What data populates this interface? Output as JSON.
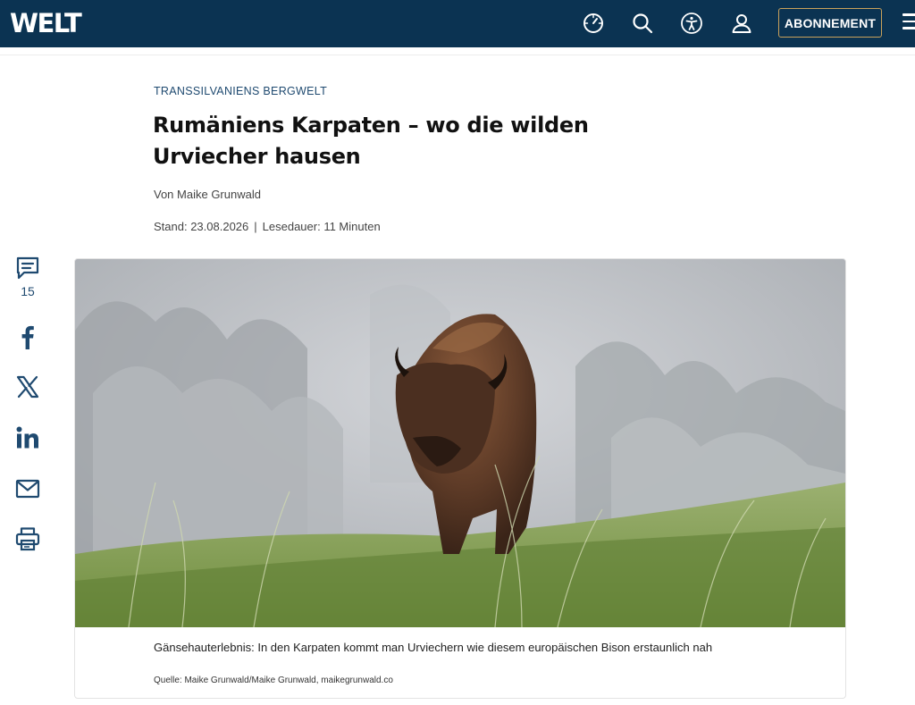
{
  "header": {
    "logo": "WELT",
    "subscribe_label": "ABONNEMENT",
    "icons": [
      "clock-icon",
      "search-icon",
      "accessibility-icon",
      "user-icon",
      "menu-icon"
    ],
    "brand_color": "#0b3352",
    "accent_color": "#c9a15b"
  },
  "article": {
    "kicker": "TRANSSILVANIENS BERGWELT",
    "title": "Rumäniens Karpaten – wo die wilden Urviecher hausen",
    "author": "Von Maike Grunwald",
    "stand": "Stand: 23.08.2026",
    "separator": "|",
    "reading_time": "Lesedauer: 11 Minuten"
  },
  "share": {
    "comment_count": "15",
    "icons": [
      "comment-icon",
      "facebook-icon",
      "x-icon",
      "linkedin-icon",
      "mail-icon",
      "print-icon"
    ]
  },
  "figure": {
    "caption": "Gänsehauterlebnis: In den Karpaten kommt man Urviechern wie diesem europäischen Bison erstaunlich nah",
    "credit": "Quelle: Maike Grunwald/Maike Grunwald, maikegrunwald.co"
  }
}
